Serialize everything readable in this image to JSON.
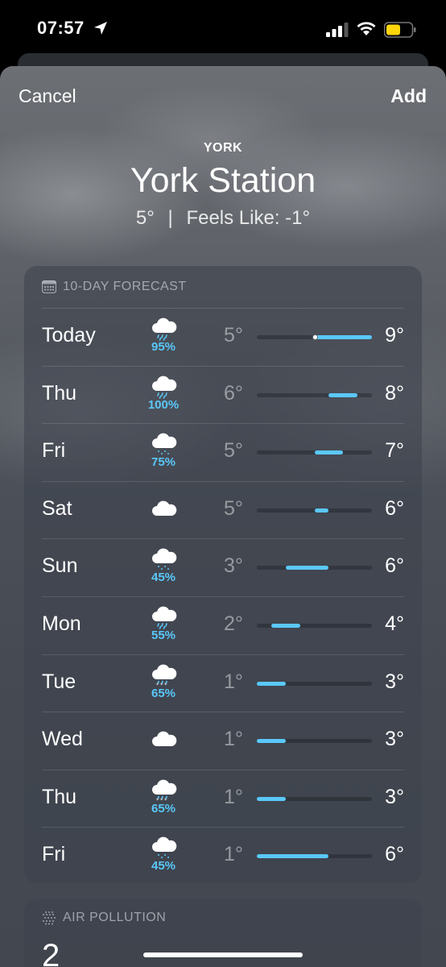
{
  "status_bar": {
    "time": "07:57"
  },
  "nav": {
    "cancel_label": "Cancel",
    "add_label": "Add"
  },
  "location": {
    "city": "YORK",
    "station": "York Station",
    "temperature": "5°",
    "separator": "|",
    "feels_like": "Feels Like: -1°"
  },
  "forecast": {
    "title": "10-DAY FORECAST",
    "scale_min": 1,
    "scale_max": 9,
    "current_temp": 5,
    "days": [
      {
        "day": "Today",
        "icon": "cloud-rain-icon",
        "precip": "95%",
        "low": "5°",
        "high": "9°",
        "low_val": 5,
        "high_val": 9
      },
      {
        "day": "Thu",
        "icon": "cloud-rain-icon",
        "precip": "100%",
        "low": "6°",
        "high": "8°",
        "low_val": 6,
        "high_val": 8
      },
      {
        "day": "Fri",
        "icon": "cloud-drizzle-icon",
        "precip": "75%",
        "low": "5°",
        "high": "7°",
        "low_val": 5,
        "high_val": 7
      },
      {
        "day": "Sat",
        "icon": "cloud-icon",
        "precip": "",
        "low": "5°",
        "high": "6°",
        "low_val": 5,
        "high_val": 6
      },
      {
        "day": "Sun",
        "icon": "cloud-drizzle-icon",
        "precip": "45%",
        "low": "3°",
        "high": "6°",
        "low_val": 3,
        "high_val": 6
      },
      {
        "day": "Mon",
        "icon": "cloud-rain-icon",
        "precip": "55%",
        "low": "2°",
        "high": "4°",
        "low_val": 2,
        "high_val": 4
      },
      {
        "day": "Tue",
        "icon": "cloud-sleet-icon",
        "precip": "65%",
        "low": "1°",
        "high": "3°",
        "low_val": 1,
        "high_val": 3
      },
      {
        "day": "Wed",
        "icon": "cloud-icon",
        "precip": "",
        "low": "1°",
        "high": "3°",
        "low_val": 1,
        "high_val": 3
      },
      {
        "day": "Thu",
        "icon": "cloud-sleet-icon",
        "precip": "65%",
        "low": "1°",
        "high": "3°",
        "low_val": 1,
        "high_val": 3
      },
      {
        "day": "Fri",
        "icon": "cloud-drizzle-icon",
        "precip": "45%",
        "low": "1°",
        "high": "6°",
        "low_val": 1,
        "high_val": 6
      }
    ]
  },
  "air_pollution": {
    "title": "AIR POLLUTION",
    "value": "2"
  },
  "colors": {
    "accent": "#5ac8fa",
    "battery": "#ffd60a"
  }
}
